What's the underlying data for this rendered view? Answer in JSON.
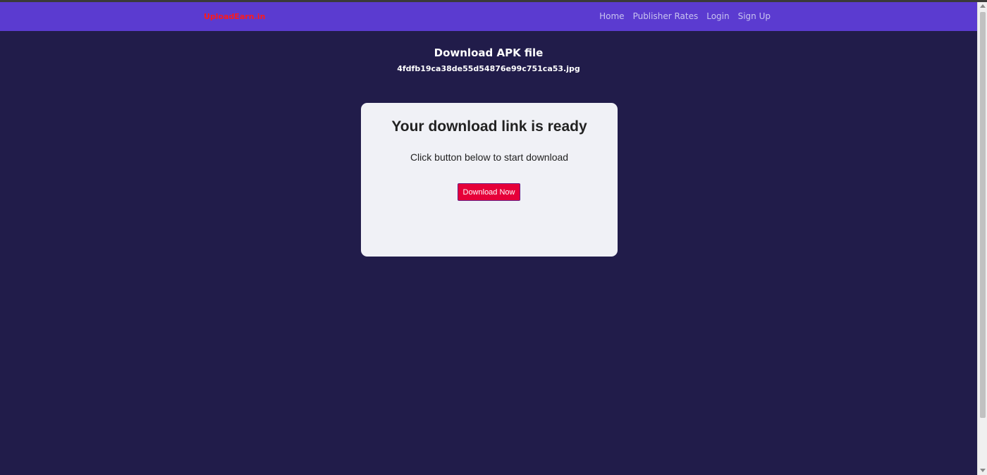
{
  "navbar": {
    "brand": "UploadEarn.in",
    "links": [
      "Home",
      "Publisher Rates",
      "Login",
      "Sign Up"
    ]
  },
  "main": {
    "heading": "Download APK file",
    "file_name": "4fdfb19ca38de55d54876e99c751ca53.jpg"
  },
  "card": {
    "title": "Your download link is ready",
    "instruction": "Click button below to start download",
    "button_label": "Download Now"
  },
  "colors": {
    "background": "#211c4a",
    "navbar": "#5b3bd0",
    "brand": "#ff1a1a",
    "card": "#f0f1f6",
    "button": "#e60039"
  }
}
